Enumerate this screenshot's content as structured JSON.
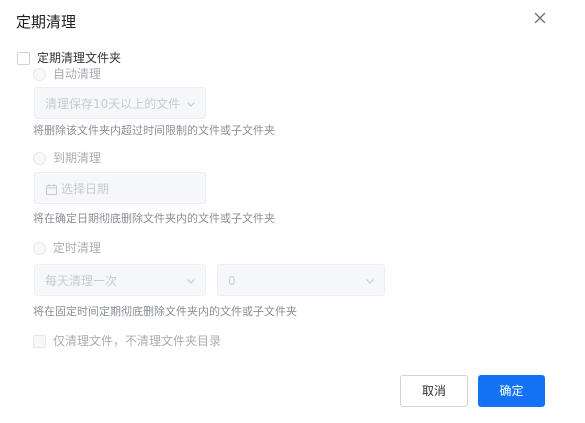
{
  "dialog": {
    "title": "定期清理",
    "close_icon": "close-icon"
  },
  "periodic_cleanup_checkbox": {
    "label": "定期清理文件夹",
    "checked": false
  },
  "auto_cleanup": {
    "label": "自动清理",
    "select_value": "清理保存10天以上的文件",
    "hint": "将删除该文件夹内超过时间限制的文件或子文件夹"
  },
  "expiry_cleanup": {
    "label": "到期清理",
    "date_placeholder": "选择日期",
    "hint": "将在确定日期彻底删除文件夹内的文件或子文件夹"
  },
  "scheduled_cleanup": {
    "label": "定时清理",
    "frequency_value": "每天清理一次",
    "hour_value": "0",
    "hint": "将在固定时间定期彻底删除文件夹内的文件或子文件夹"
  },
  "files_only_checkbox": {
    "label": "仅清理文件，不清理文件夹目录",
    "checked": false
  },
  "buttons": {
    "cancel": "取消",
    "confirm": "确定"
  },
  "colors": {
    "primary": "#1473f5",
    "disabled_text": "#c7cbd1",
    "input_background": "#f5f7fa"
  }
}
